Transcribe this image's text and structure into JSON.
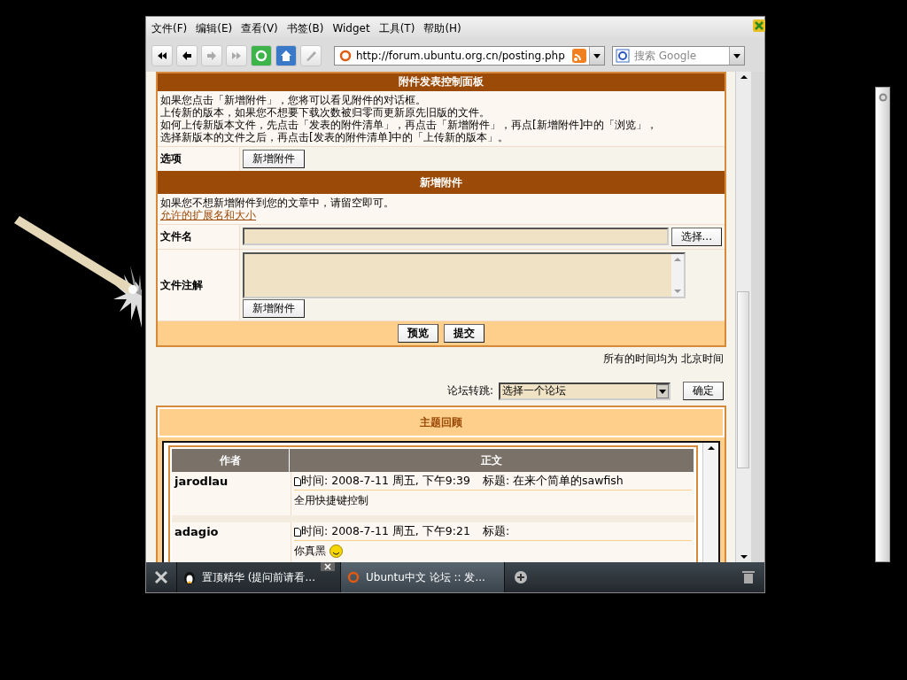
{
  "menubar": [
    "文件(F)",
    "编辑(E)",
    "查看(V)",
    "书签(B)",
    "Widget",
    "工具(T)",
    "帮助(H)"
  ],
  "address": {
    "value": "http://forum.ubuntu.org.cn/posting.php"
  },
  "search": {
    "placeholder": "搜索 Google"
  },
  "attach_panel": {
    "title": "附件发表控制面板",
    "notes": [
      "如果您点击「新增附件」，您将可以看见附件的对话框。",
      "上传新的版本，如果您不想要下载次数被归零而更新原先旧版的文件。",
      "如何上传新版本文件，先点击「发表的附件清单」，再点击「新增附件」，再点[新增附件]中的「浏览」，",
      "选择新版本的文件之后，再点击[发表的附件清单]中的「上传新的版本」。"
    ],
    "option_label": "选项",
    "option_button": "新增附件"
  },
  "new_attachment": {
    "title": "新增附件",
    "note": "如果您不想新增附件到您的文章中，请留空即可。",
    "link": "允许的扩展名和大小",
    "filename_label": "文件名",
    "choose_button": "选择...",
    "comment_label": "文件注解",
    "add_button": "新增附件",
    "preview_button": "预览",
    "submit_button": "提交"
  },
  "timezone_note": "所有的时间均为 北京时间",
  "jump": {
    "label": "论坛转跳:",
    "select": "选择一个论坛",
    "button": "确定"
  },
  "review": {
    "title": "主题回顾",
    "columns": [
      "作者",
      "正文"
    ],
    "posts": [
      {
        "author": "jarodlau",
        "time": "时间: 2008-7-11 周五, 下午9:39",
        "subject": "标题: 在来个简单的sawfish",
        "body": "全用快捷键控制",
        "emoticon": false
      },
      {
        "author": "adagio",
        "time": "时间: 2008-7-11 周五, 下午9:21",
        "subject": "标题:",
        "body": "你真黑",
        "emoticon": true
      }
    ]
  },
  "tabs": [
    {
      "label": "置顶精华 (提问前请看...",
      "selected": false
    },
    {
      "label": "Ubuntu中文 论坛 :: 发...",
      "selected": true
    }
  ]
}
